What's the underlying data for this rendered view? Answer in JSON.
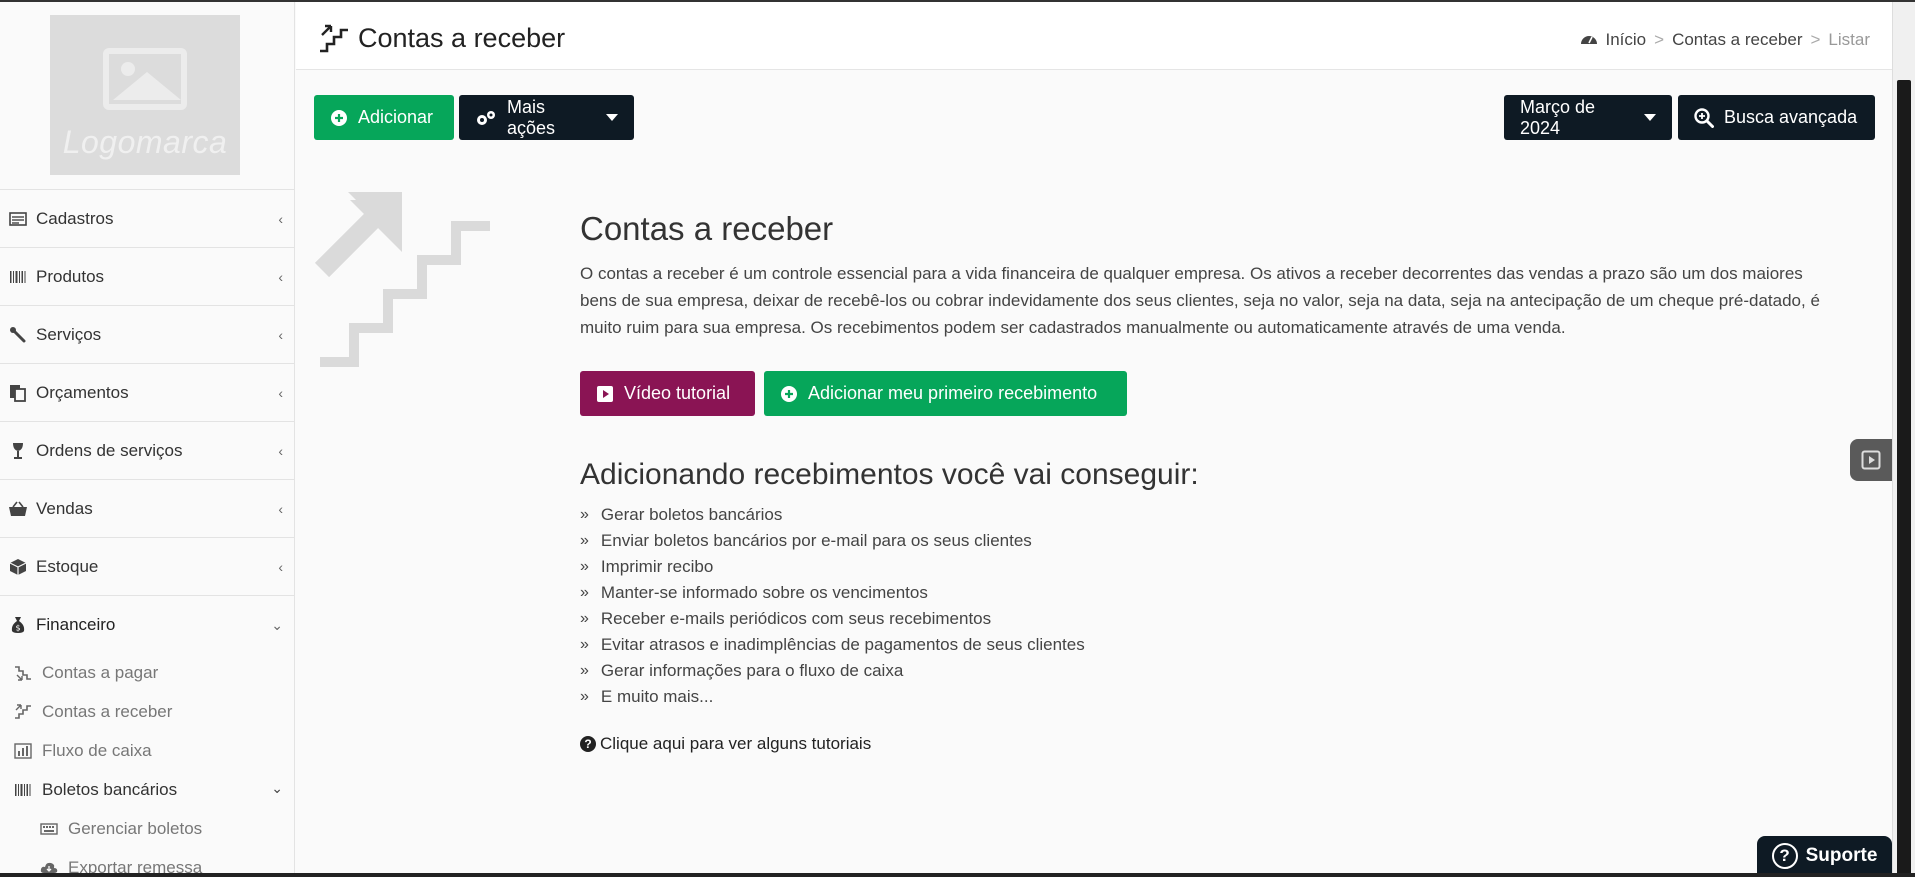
{
  "logo": {
    "text": "Logomarca"
  },
  "sidebar": {
    "items": [
      {
        "label": "Cadastros",
        "icon": "id-card-icon"
      },
      {
        "label": "Produtos",
        "icon": "barcode-icon"
      },
      {
        "label": "Serviços",
        "icon": "wrench-icon"
      },
      {
        "label": "Orçamentos",
        "icon": "documents-icon"
      },
      {
        "label": "Ordens de serviços",
        "icon": "wine-glass-icon"
      },
      {
        "label": "Vendas",
        "icon": "basket-icon"
      },
      {
        "label": "Estoque",
        "icon": "box-icon"
      },
      {
        "label": "Financeiro",
        "icon": "money-bag-icon"
      }
    ],
    "financeiro_sub": [
      {
        "label": "Contas a pagar",
        "icon": "stairs-down-icon"
      },
      {
        "label": "Contas a receber",
        "icon": "stairs-up-icon"
      },
      {
        "label": "Fluxo de caixa",
        "icon": "bar-chart-icon"
      },
      {
        "label": "Boletos bancários",
        "icon": "barcode-icon"
      }
    ],
    "boletos_sub": [
      {
        "label": "Gerenciar boletos",
        "icon": "keyboard-icon"
      },
      {
        "label": "Exportar remessa",
        "icon": "cloud-download-icon"
      }
    ]
  },
  "header": {
    "title": "Contas a receber",
    "breadcrumb": {
      "home": "Início",
      "section": "Contas a receber",
      "current": "Listar",
      "separator": ">"
    }
  },
  "toolbar": {
    "add_label": "Adicionar",
    "more_actions_label": "Mais ações",
    "period_label": "Março de 2024",
    "advanced_search_label": "Busca avançada"
  },
  "main": {
    "title": "Contas a receber",
    "description": "O contas a receber é um controle essencial para a vida financeira de qualquer empresa. Os ativos a receber decorrentes das vendas a prazo são um dos maiores bens de sua empresa, deixar de recebê-los ou cobrar indevidamente dos seus clientes, seja no valor, seja na data, seja na antecipação de um cheque pré-datado, é muito ruim para sua empresa. Os recebimentos podem ser cadastrados manualmente ou automaticamente através de uma venda.",
    "video_label": "Vídeo tutorial",
    "first_label": "Adicionar meu primeiro recebimento",
    "benefits_title": "Adicionando recebimentos você vai conseguir:",
    "benefits": [
      "Gerar boletos bancários",
      "Enviar boletos bancários por e-mail para os seus clientes",
      "Imprimir recibo",
      "Manter-se informado sobre os vencimentos",
      "Receber e-mails periódicos com seus recebimentos",
      "Evitar atrasos e inadimplências de pagamentos de seus clientes",
      "Gerar informações para o fluxo de caixa",
      "E muito mais..."
    ],
    "tutorial_link": "Clique aqui para ver alguns tutoriais",
    "bullet": "»"
  },
  "support": {
    "label": "Suporte"
  },
  "colors": {
    "green": "#06a65a",
    "dark": "#0e1a24",
    "purple": "#8a1454"
  }
}
